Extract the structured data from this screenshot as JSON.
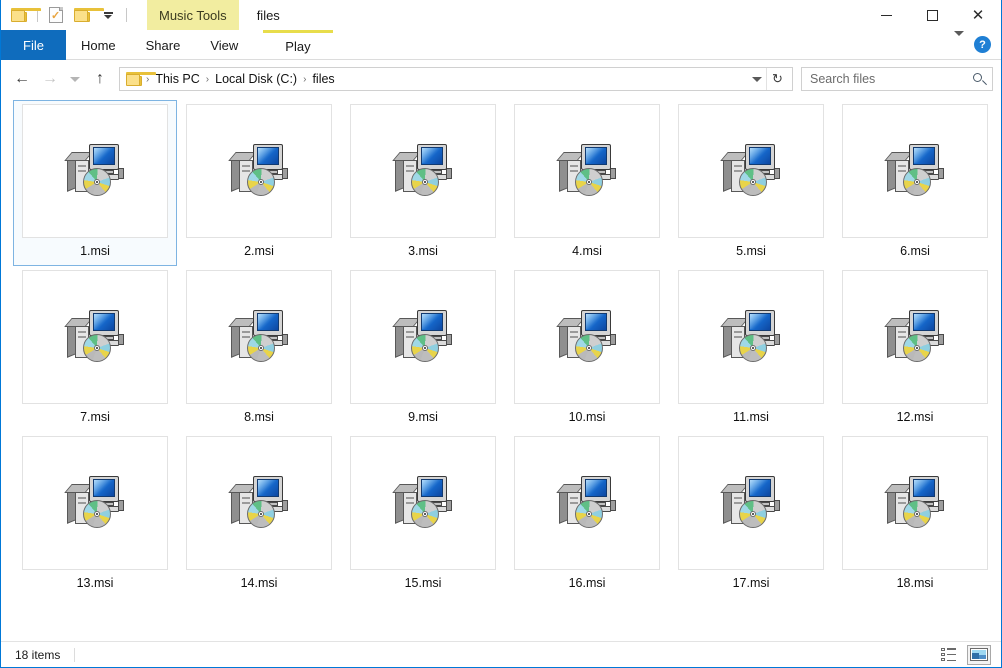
{
  "window": {
    "title": "files",
    "contextual_tab_group": "Music Tools",
    "controls": {
      "minimize": "minimize-button",
      "maximize": "maximize-button",
      "close": "close-button"
    },
    "accent_color": "#0078d7",
    "contextual_color": "#f2eda0"
  },
  "quick_access": {
    "items": [
      {
        "icon": "folder-icon",
        "name": "quick-access-folder"
      },
      {
        "icon": "properties-icon",
        "name": "quick-access-properties"
      },
      {
        "icon": "folder-icon",
        "name": "quick-access-new-folder"
      },
      {
        "icon": "chevron-down-icon",
        "name": "quick-access-customize"
      }
    ]
  },
  "ribbon": {
    "tabs": [
      {
        "label": "File",
        "active": true,
        "style": "file"
      },
      {
        "label": "Home",
        "active": false
      },
      {
        "label": "Share",
        "active": false
      },
      {
        "label": "View",
        "active": false
      },
      {
        "label": "Play",
        "active": false,
        "contextual": true
      }
    ],
    "expand_icon": "chevron-down-icon",
    "help_icon": "help-icon",
    "help_glyph": "?"
  },
  "address_bar": {
    "back": "←",
    "forward": "→",
    "recent": "⌄",
    "up": "↑",
    "breadcrumb": [
      "This PC",
      "Local Disk (C:)",
      "files"
    ],
    "separator": "›",
    "dropdown_icon": "chevron-down-icon",
    "refresh_icon": "refresh-icon",
    "refresh_glyph": "↻"
  },
  "search": {
    "placeholder": "Search files",
    "value": "",
    "icon": "search-icon"
  },
  "files": {
    "icon_type": "msi-installer-icon",
    "items": [
      {
        "name": "1.msi",
        "selected": true
      },
      {
        "name": "2.msi",
        "selected": false
      },
      {
        "name": "3.msi",
        "selected": false
      },
      {
        "name": "4.msi",
        "selected": false
      },
      {
        "name": "5.msi",
        "selected": false
      },
      {
        "name": "6.msi",
        "selected": false
      },
      {
        "name": "7.msi",
        "selected": false
      },
      {
        "name": "8.msi",
        "selected": false
      },
      {
        "name": "9.msi",
        "selected": false
      },
      {
        "name": "10.msi",
        "selected": false
      },
      {
        "name": "11.msi",
        "selected": false
      },
      {
        "name": "12.msi",
        "selected": false
      },
      {
        "name": "13.msi",
        "selected": false
      },
      {
        "name": "14.msi",
        "selected": false
      },
      {
        "name": "15.msi",
        "selected": false
      },
      {
        "name": "16.msi",
        "selected": false
      },
      {
        "name": "17.msi",
        "selected": false
      },
      {
        "name": "18.msi",
        "selected": false
      }
    ]
  },
  "status_bar": {
    "item_count": "18 items",
    "views": [
      {
        "name": "details-view-button",
        "active": false
      },
      {
        "name": "large-icons-view-button",
        "active": true
      }
    ]
  }
}
